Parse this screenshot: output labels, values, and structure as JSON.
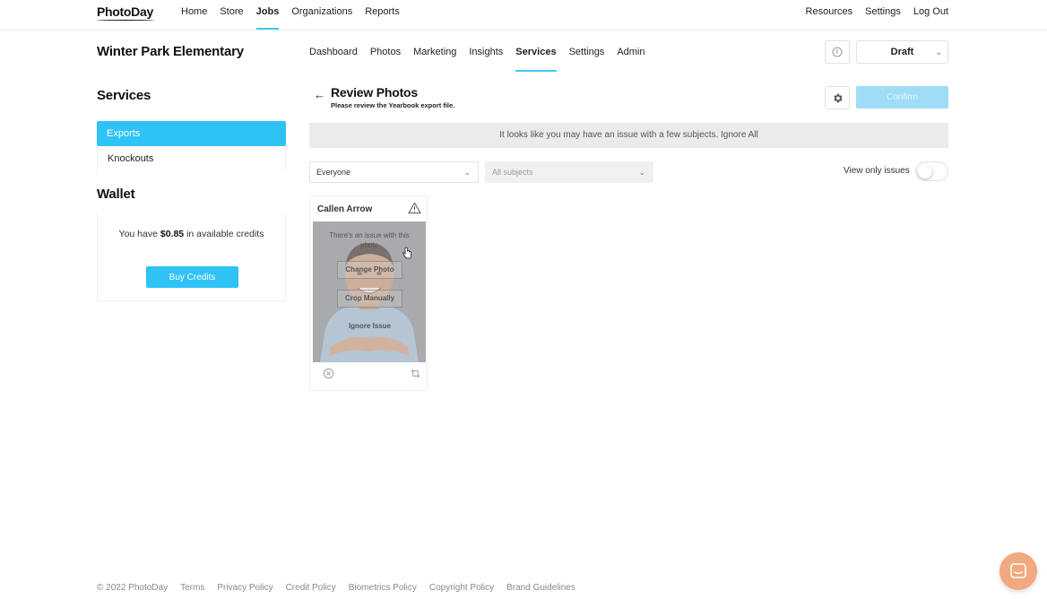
{
  "brand": {
    "logo_text": "PhotoDay"
  },
  "topnav": {
    "left": [
      "Home",
      "Store",
      "Jobs",
      "Organizations",
      "Reports"
    ],
    "active": "Jobs",
    "right": [
      "Resources",
      "Settings",
      "Log Out"
    ]
  },
  "job": {
    "name": "Winter Park Elementary",
    "tabs": [
      "Dashboard",
      "Photos",
      "Marketing",
      "Insights",
      "Services",
      "Settings",
      "Admin"
    ],
    "active_tab": "Services",
    "status": "Draft"
  },
  "sidebar": {
    "services_heading": "Services",
    "items": [
      "Exports",
      "Knockouts"
    ],
    "active_item": "Exports",
    "wallet_heading": "Wallet",
    "wallet_prefix": "You have ",
    "wallet_amount": "$0.85",
    "wallet_suffix": " in available credits",
    "buy_label": "Buy Credits"
  },
  "main": {
    "back": "←",
    "title": "Review Photos",
    "subtitle": "Please review the Yearbook export file.",
    "confirm_label": "Confirm",
    "alert": "It looks like you may have an issue with a few subjects. Ignore All",
    "filter_people": "Everyone",
    "filter_subjects": "All subjects",
    "view_issues_label": "View only issues",
    "view_issues_on": false
  },
  "card": {
    "name": "Callen Arrow",
    "issue_text": "There's an issue with this photo",
    "change_photo": "Change Photo",
    "crop_manually": "Crop Manually",
    "ignore_issue": "Ignore Issue"
  },
  "footer": {
    "copyright": "© 2022 PhotoDay",
    "links": [
      "Terms",
      "Privacy Policy",
      "Credit Policy",
      "Biometrics Policy",
      "Copyright Policy",
      "Brand Guidelines"
    ]
  },
  "colors": {
    "accent": "#2fc2f5",
    "chat": "#f1a97f"
  }
}
